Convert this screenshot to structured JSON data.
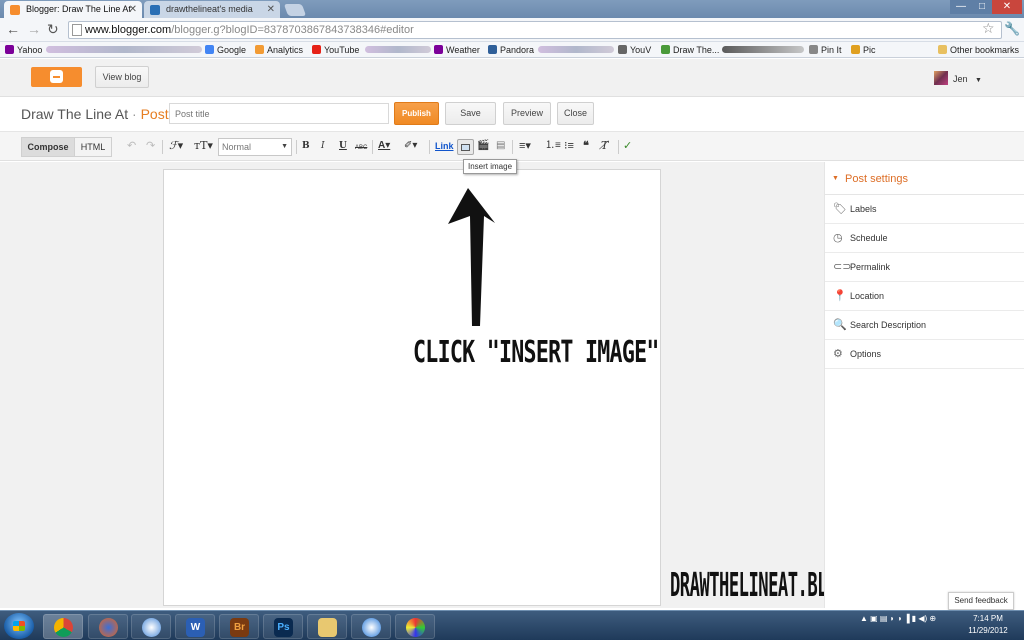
{
  "browser": {
    "tabs": [
      {
        "label": "Blogger: Draw The Line At",
        "active": true
      },
      {
        "label": "drawthelineat's media",
        "active": false
      }
    ],
    "url_domain": "www.blogger.com",
    "url_rest": "/blogger.g?blogID=8378703867843738346#editor",
    "window_controls": [
      "—",
      "□",
      "✕"
    ]
  },
  "bookmarks": [
    "Yahoo",
    "Google",
    "Analytics",
    "YouTube",
    "Weather",
    "Pandora",
    "YouV",
    "Draw The...",
    "Pin It",
    "Pic",
    "Other bookmarks"
  ],
  "blogger": {
    "view_blog": "View blog",
    "user": "Jen",
    "blog_name": "Draw The Line At",
    "separator": "·",
    "post_label": "Post",
    "post_title_placeholder": "Post title",
    "buttons": {
      "publish": "Publish",
      "save": "Save",
      "preview": "Preview",
      "close": "Close"
    }
  },
  "editor_toolbar": {
    "compose": "Compose",
    "html": "HTML",
    "font_size": "Normal",
    "bold": "B",
    "italic": "I",
    "underline": "U",
    "strike": "ABC",
    "link": "Link",
    "tooltip": "Insert image"
  },
  "canvas": {
    "annotation": "CLICK \"INSERT IMAGE\"",
    "watermark": "DRAWTHELINEAT.BLOGSPOT.COM"
  },
  "side_panel": {
    "title": "Post settings",
    "items": [
      "Labels",
      "Schedule",
      "Permalink",
      "Location",
      "Search Description",
      "Options"
    ]
  },
  "feedback": "Send feedback",
  "taskbar": {
    "time": "7:14 PM",
    "date": "11/29/2012"
  },
  "colors": {
    "accent": "#f08a24",
    "brand": "#f68d2e",
    "link": "#1155cc"
  }
}
